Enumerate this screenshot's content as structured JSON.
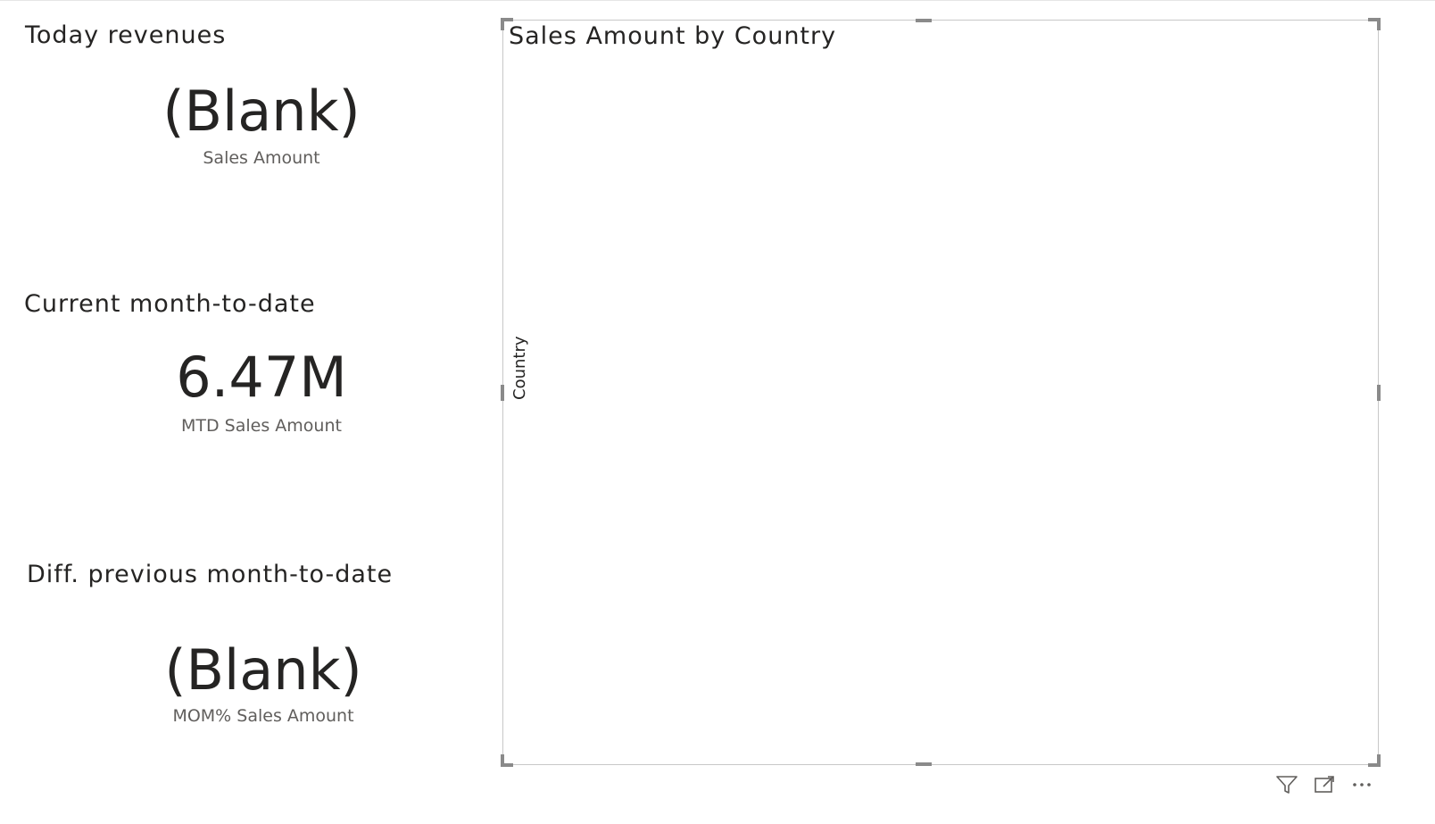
{
  "cards": [
    {
      "title": "Today revenues",
      "value": "(Blank)",
      "label": "Sales Amount"
    },
    {
      "title": "Current month-to-date",
      "value": "6.47M",
      "label": "MTD Sales Amount"
    },
    {
      "title": "Diff. previous month-to-date",
      "value": "(Blank)",
      "label": "MOM% Sales Amount"
    }
  ],
  "visual": {
    "title": "Sales Amount by Country",
    "axis_label": "Country",
    "toolbar": {
      "filter_icon": "filter-icon",
      "focus_icon": "focus-mode-icon",
      "more_icon": "more-options-icon"
    }
  },
  "colors": {
    "text": "#252423",
    "subtext": "#605e5c",
    "border": "#c8c8c8",
    "handle": "#8a8a8a"
  }
}
